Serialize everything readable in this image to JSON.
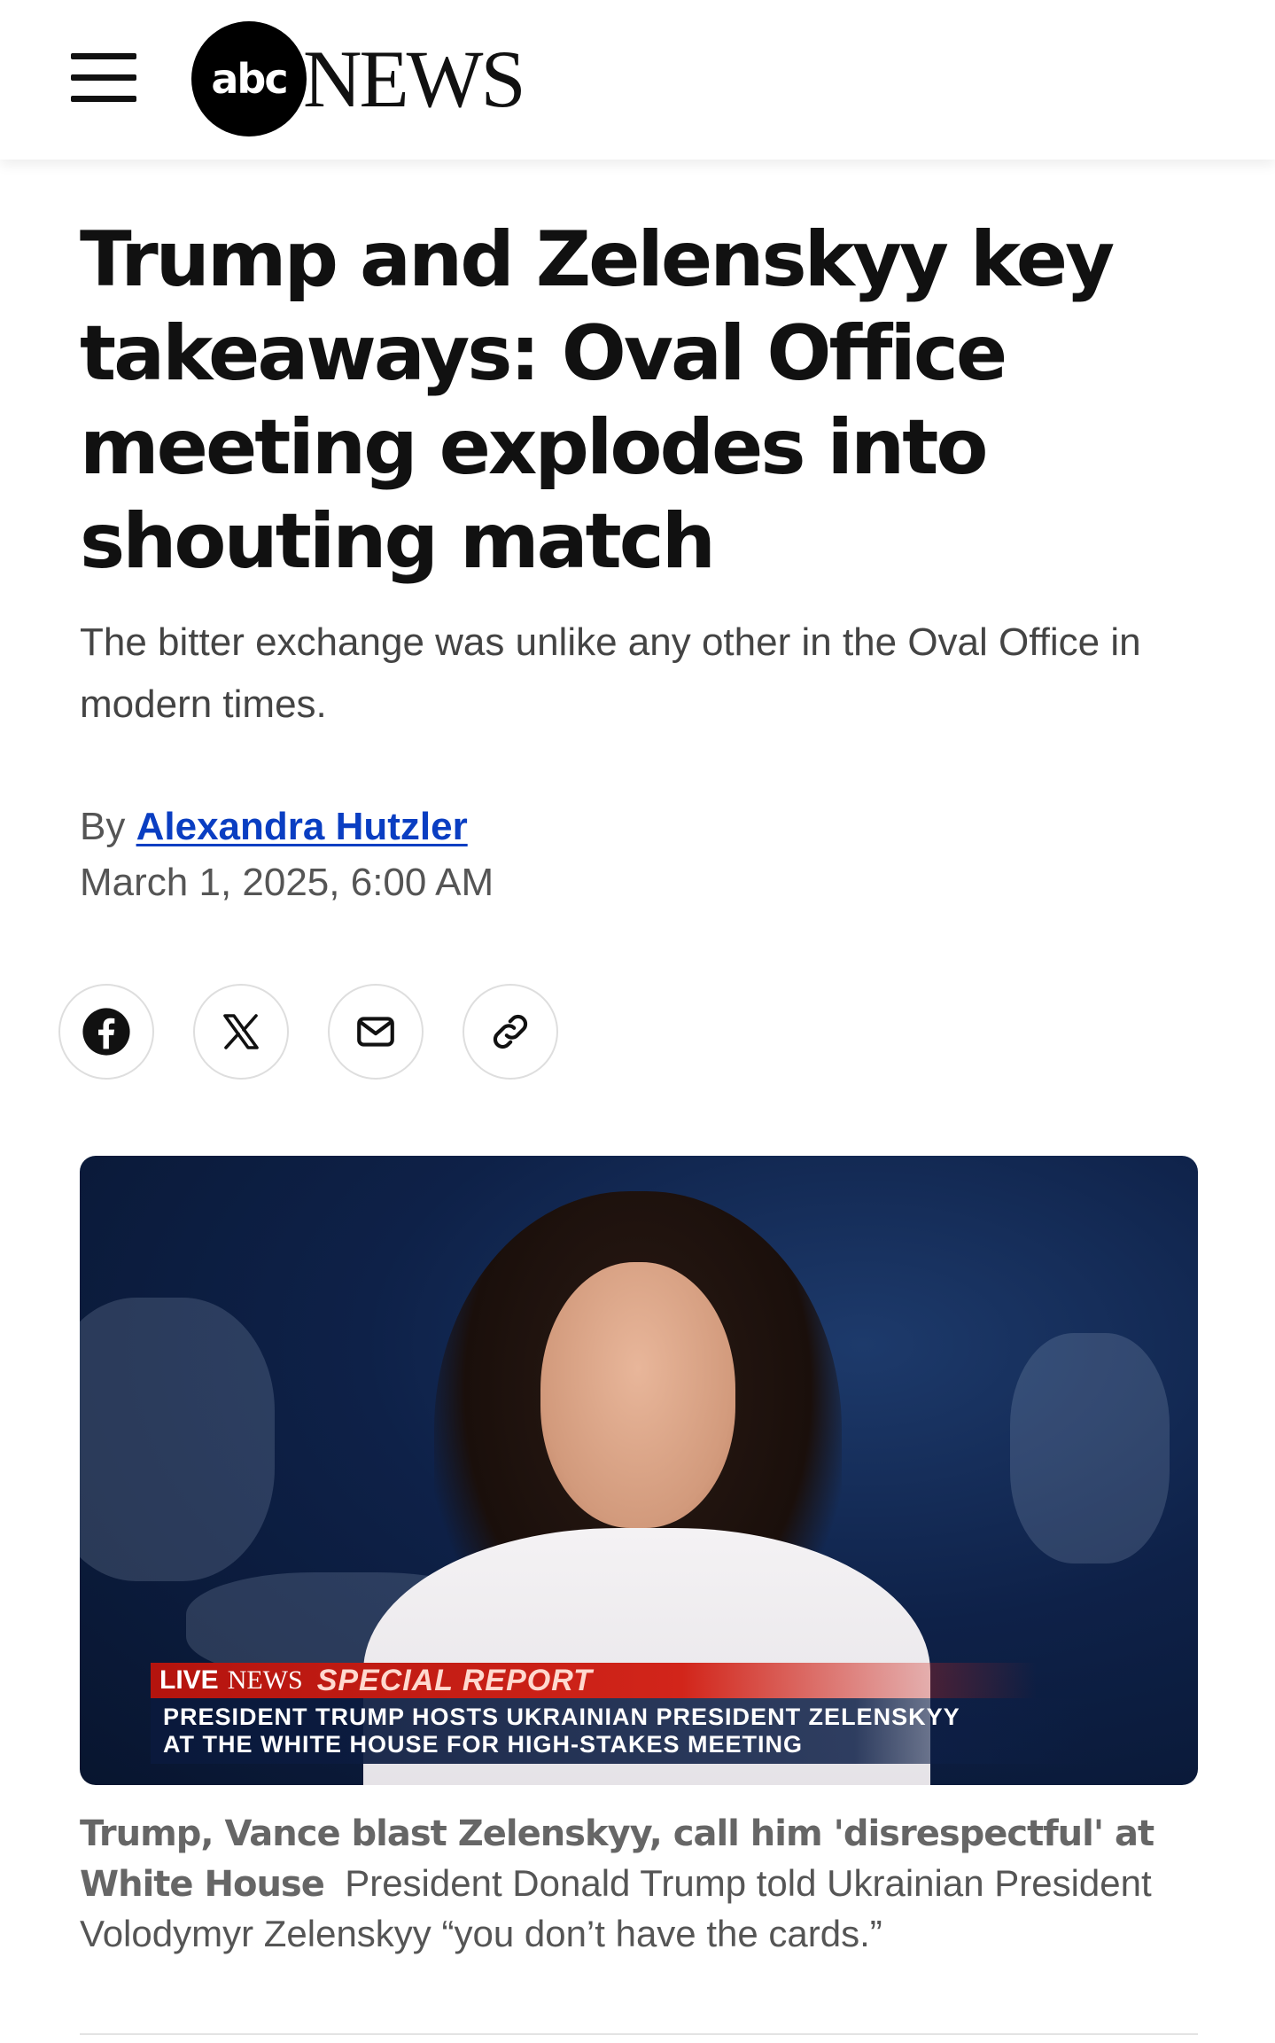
{
  "header": {
    "menu_icon": "hamburger-menu-icon",
    "logo": {
      "abc": "abc",
      "news": "NEWS"
    }
  },
  "article": {
    "headline": "Trump and Zelenskyy key takeaways: Oval Office meeting explodes into shouting match",
    "subheadline": "The bitter exchange was unlike any other in the Oval Office in modern times.",
    "byline_prefix": "By",
    "author": "Alexandra Hutzler",
    "date": "March 1, 2025, 6:00 AM"
  },
  "share": [
    {
      "icon": "facebook-icon"
    },
    {
      "icon": "x-icon"
    },
    {
      "icon": "mail-icon"
    },
    {
      "icon": "link-icon"
    }
  ],
  "video": {
    "live_label": "LIVE",
    "brand_label": "NEWS",
    "special_report": "SPECIAL REPORT",
    "ticker_line1": "PRESIDENT TRUMP HOSTS UKRAINIAN PRESIDENT ZELENSKYY",
    "ticker_line2": "AT THE WHITE HOUSE FOR HIGH-STAKES MEETING",
    "caption_title": "Trump, Vance blast Zelenskyy, call him 'disrespectful' at White House",
    "caption_text": "President Donald Trump told Ukrainian President Volodymyr Zelenskyy “you don’t have the cards.”"
  },
  "colors": {
    "link": "#0a3ec2",
    "ticker_red": "#d2251a",
    "ticker_blue": "#0e2048"
  }
}
